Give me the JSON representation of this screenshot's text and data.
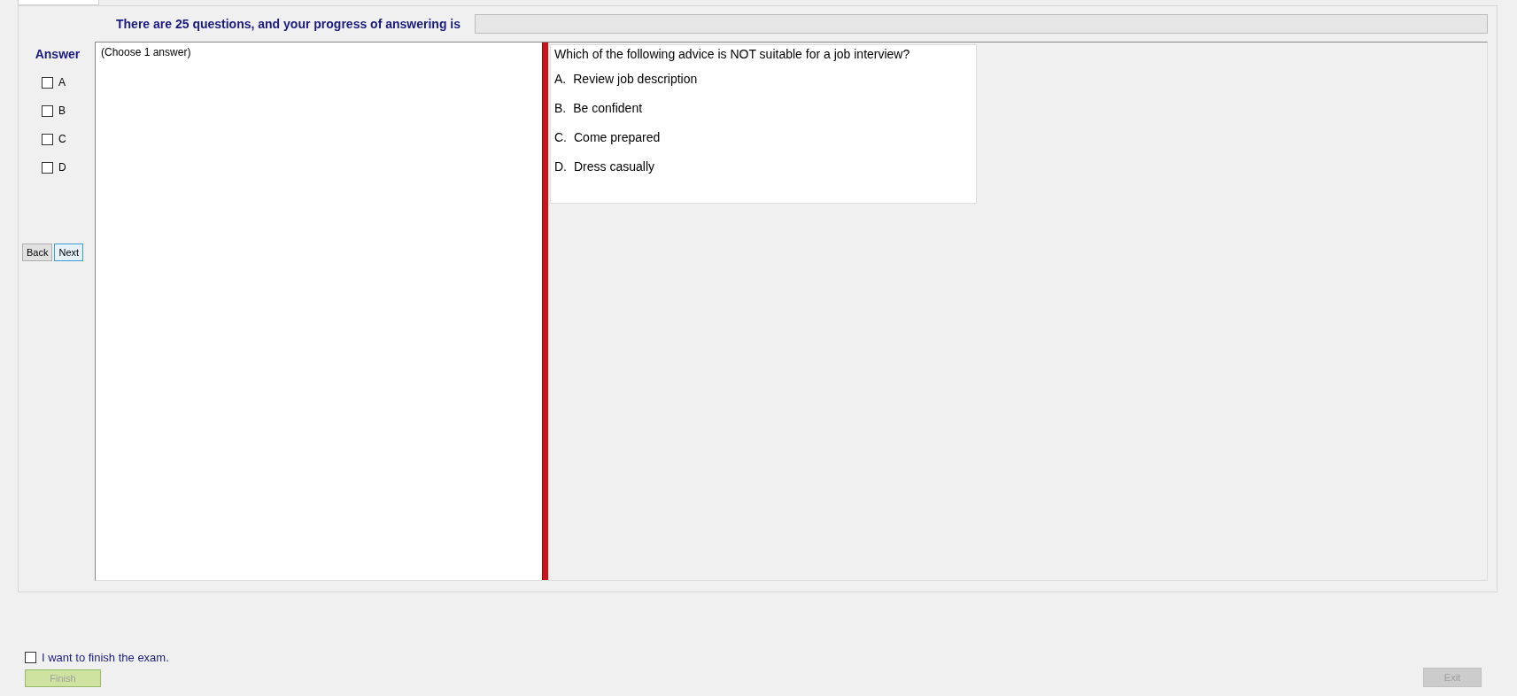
{
  "header": {
    "text": "There are 25 questions, and your progress of answering is",
    "progress": {
      "level": 0
    }
  },
  "answer_panel": {
    "title": "Answer",
    "options": [
      {
        "label": "A",
        "checked": false
      },
      {
        "label": "B",
        "checked": false
      },
      {
        "label": "C",
        "checked": false
      },
      {
        "label": "D",
        "checked": false
      }
    ],
    "buttons": [
      {
        "label": "Back",
        "focused": false
      },
      {
        "label": "Next",
        "focused": true
      }
    ]
  },
  "instruction": "(Choose 1 answer)",
  "question": {
    "text": "Which of the following advice is NOT suitable for a job interview?",
    "choices": [
      {
        "letter": "A.",
        "text": "Review job description"
      },
      {
        "letter": "B.",
        "text": "Be confident"
      },
      {
        "letter": "C.",
        "text": "Come prepared"
      },
      {
        "letter": "D.",
        "text": "Dress casually"
      }
    ]
  },
  "finish": {
    "label": "I want to finish the exam.",
    "checked": false,
    "button": {
      "label": "Finish",
      "disabled": true
    }
  },
  "exit": {
    "label": "Exit",
    "disabled": true
  }
}
